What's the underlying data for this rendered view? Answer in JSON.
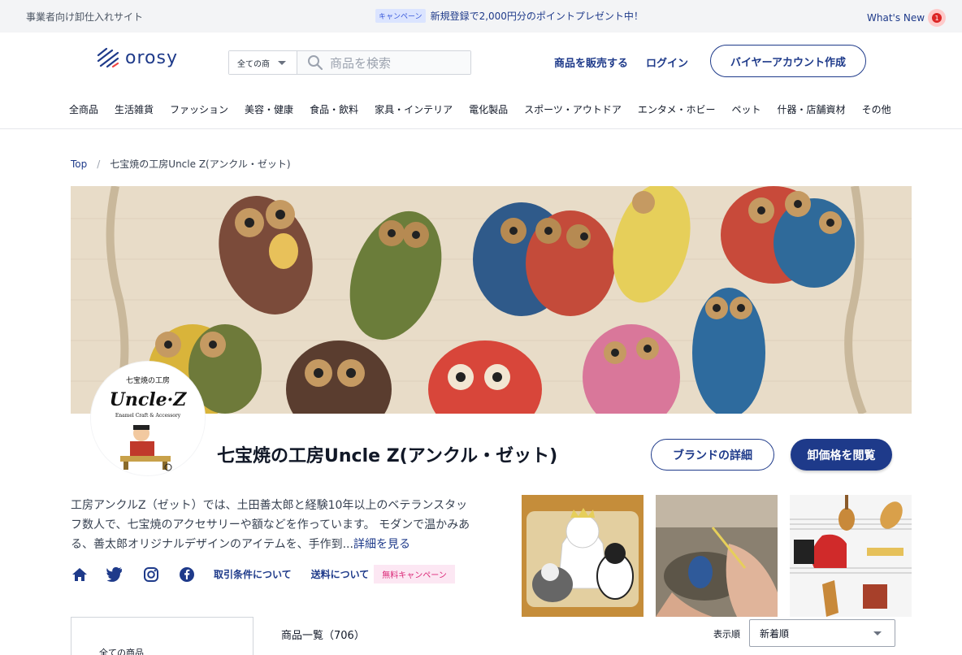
{
  "topbar": {
    "left_text": "事業者向け卸仕入れサイト",
    "campaign_tag": "キャンペーン",
    "campaign_text": "新規登録で2,000円分のポイントプレゼント中！",
    "whats_new": "What's New",
    "notif_count": "1"
  },
  "header": {
    "logo_text": "orosy",
    "search_category": "全ての商",
    "search_placeholder": "商品を検索",
    "sell_link": "商品を販売する",
    "login_link": "ログイン",
    "buyer_button": "バイヤーアカウント作成"
  },
  "categories": [
    "全商品",
    "生活雑貨",
    "ファッション",
    "美容・健康",
    "食品・飲料",
    "家具・インテリア",
    "電化製品",
    "スポーツ・アウトドア",
    "エンタメ・ホビー",
    "ペット",
    "什器・店舗資材",
    "その他"
  ],
  "breadcrumb": {
    "top": "Top",
    "separator": "/",
    "current": "七宝焼の工房Uncle Z(アンクル・ゼット)"
  },
  "brand": {
    "logo_small": "七宝焼の工房",
    "logo_main": "Uncle·Z",
    "logo_sub": "Enamel Craft & Accessory",
    "name": "七宝焼の工房Uncle Z(アンクル・ゼット)",
    "detail_button": "ブランドの詳細",
    "price_button": "卸価格を閲覧",
    "description": "工房アンクルZ（ゼット）では、土田善太郎と経験10年以上のベテランスタッフ数人で、七宝焼のアクセサリーや額などを作っています。 モダンで温かみある、善太郎オリジナルデザインのアイテムを、手作到...",
    "more": "詳細を見る",
    "terms_link": "取引条件について",
    "shipping_link": "送料について",
    "shipping_campaign": "無料キャンペーン"
  },
  "icons": [
    "home-icon",
    "twitter-icon",
    "instagram-icon",
    "facebook-icon",
    "search-icon",
    "caret-down-icon",
    "logo-icon"
  ],
  "colors": {
    "primary": "#1e3a8a",
    "campaign_pink": "#db2777",
    "banner_bg": "#e9ddc9"
  },
  "sidebar": {
    "all_products": "全ての商品"
  },
  "products": {
    "title": "商品一覧（706）",
    "sort_label": "表示順",
    "sort_value": "新着順"
  }
}
